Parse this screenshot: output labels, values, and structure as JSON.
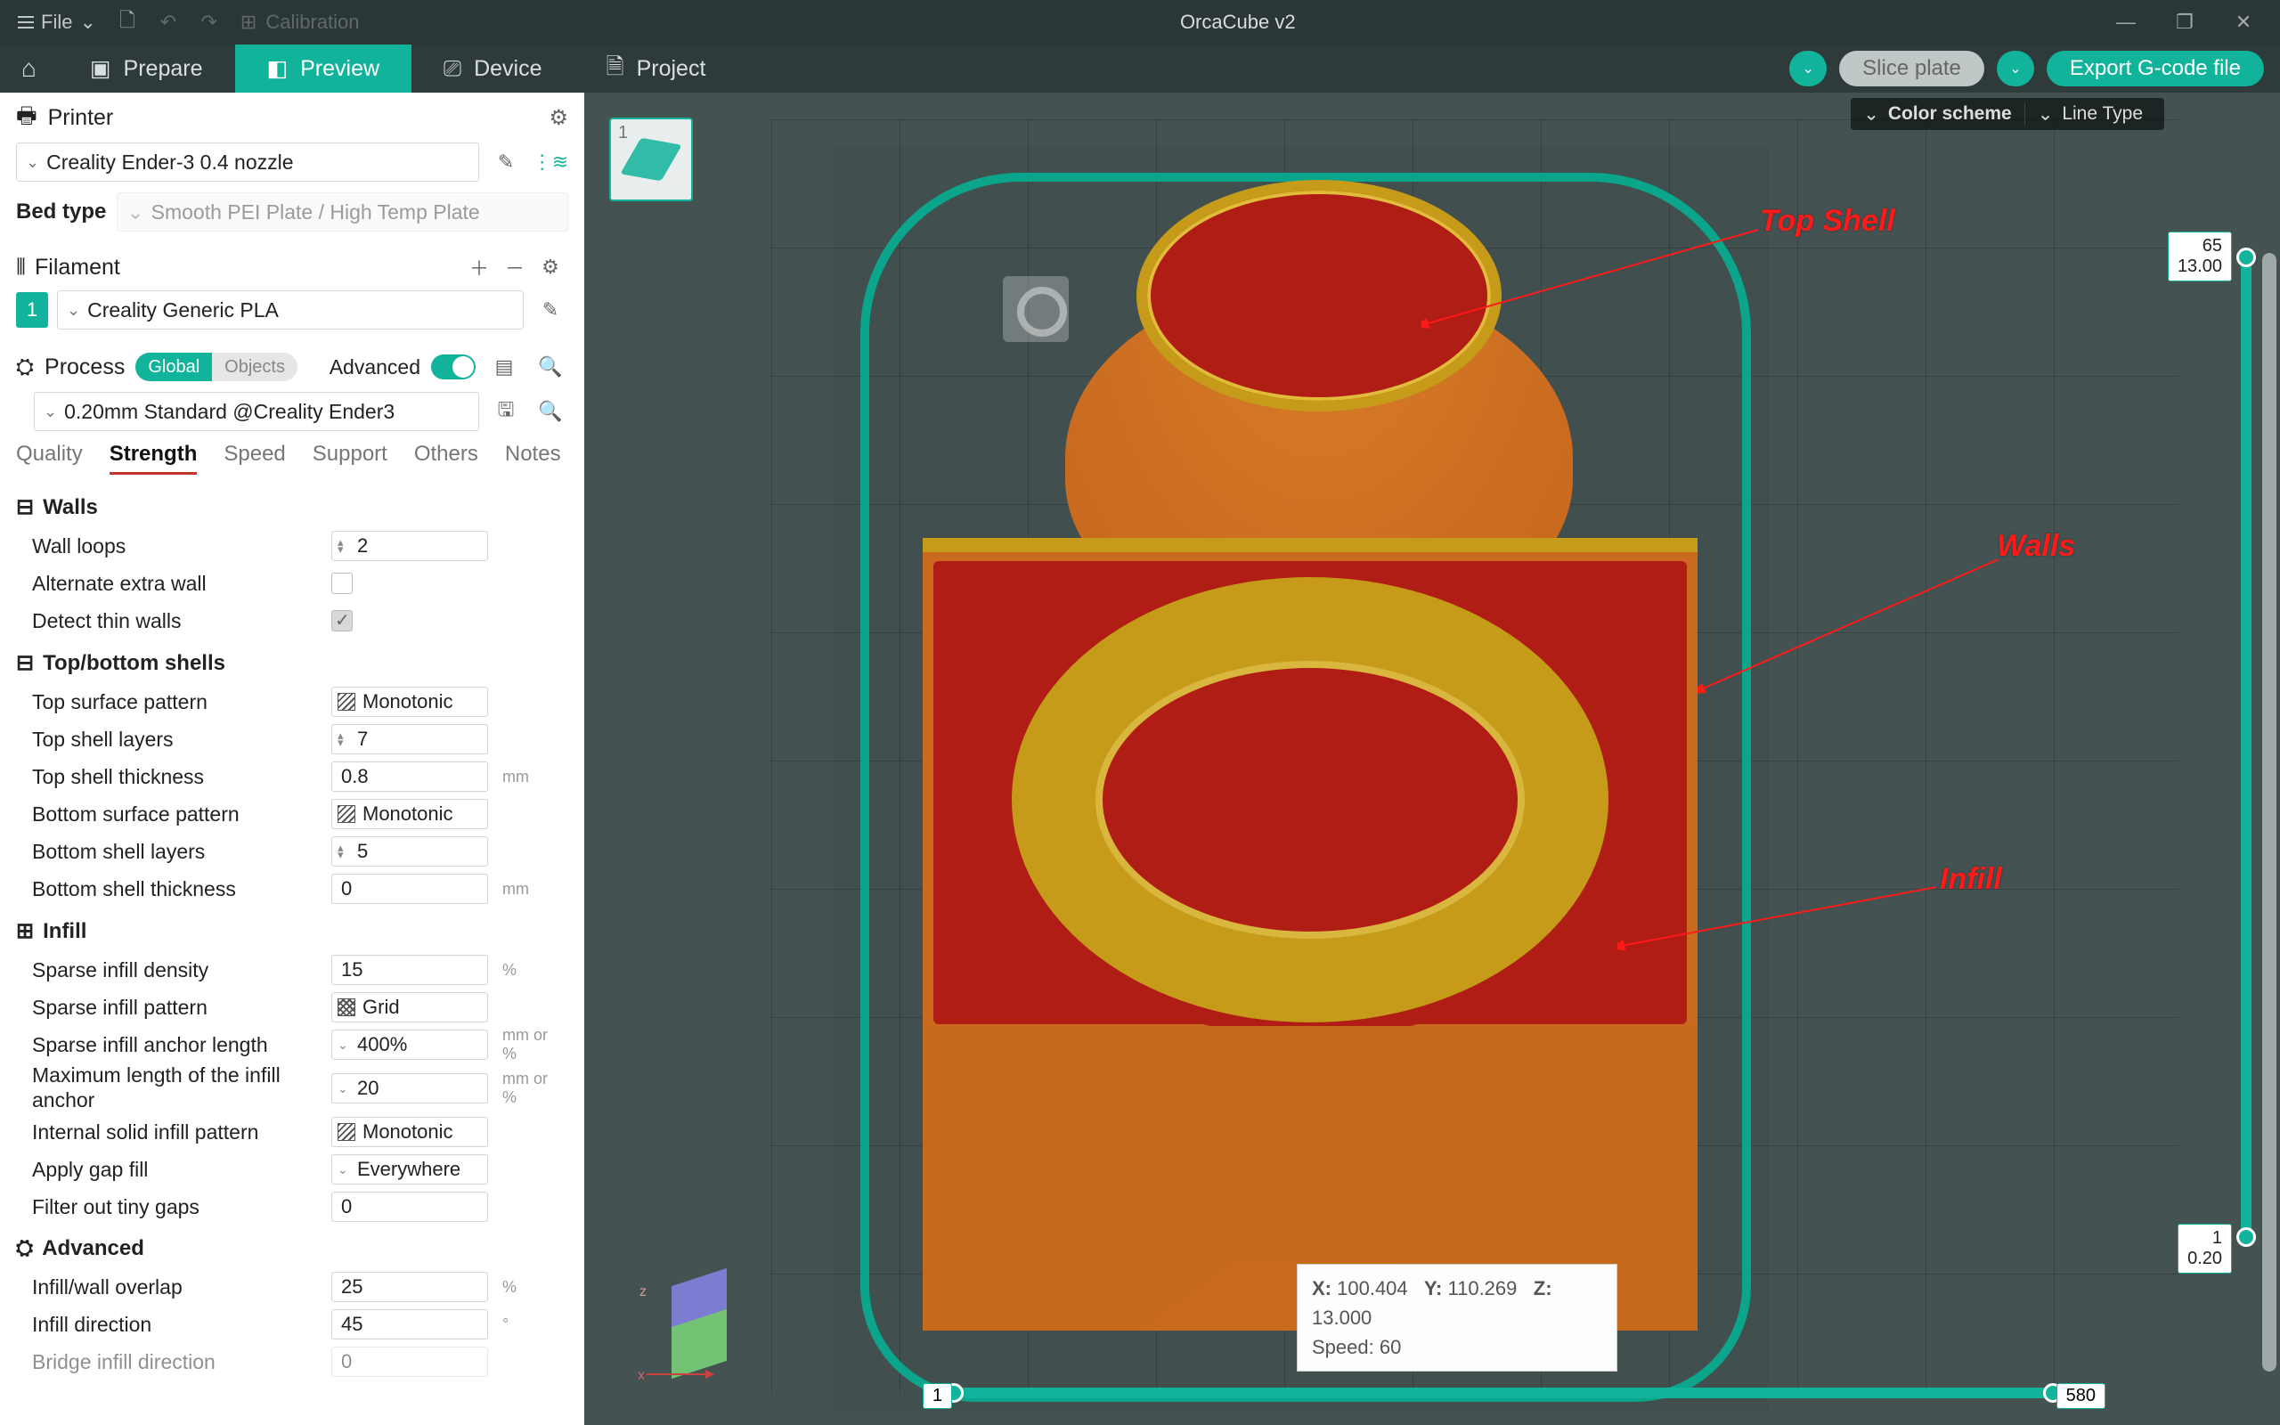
{
  "titlebar": {
    "file_label": "File",
    "calibration": "Calibration",
    "app_title": "OrcaCube v2"
  },
  "tabs": {
    "home": "",
    "prepare": "Prepare",
    "preview": "Preview",
    "device": "Device",
    "project": "Project"
  },
  "actions": {
    "slice": "Slice plate",
    "export": "Export G-code file"
  },
  "panel": {
    "printer_hdr": "Printer",
    "printer_value": "Creality Ender-3 0.4 nozzle",
    "bed_label": "Bed type",
    "bed_value": "Smooth PEI Plate / High Temp Plate",
    "filament_hdr": "Filament",
    "filament_idx": "1",
    "filament_value": "Creality Generic PLA",
    "process_hdr": "Process",
    "global": "Global",
    "objects": "Objects",
    "advanced": "Advanced",
    "process_value": "0.20mm Standard @Creality Ender3"
  },
  "ptabs": [
    "Quality",
    "Strength",
    "Speed",
    "Support",
    "Others",
    "Notes"
  ],
  "sections": {
    "walls": "Walls",
    "tb": "Top/bottom shells",
    "infill": "Infill",
    "adv": "Advanced"
  },
  "settings": {
    "wall_loops": {
      "label": "Wall loops",
      "value": "2"
    },
    "alt_extra": {
      "label": "Alternate extra wall"
    },
    "thin_walls": {
      "label": "Detect thin walls"
    },
    "top_pattern": {
      "label": "Top surface pattern",
      "value": "Monotonic"
    },
    "top_layers": {
      "label": "Top shell layers",
      "value": "7"
    },
    "top_thick": {
      "label": "Top shell thickness",
      "value": "0.8",
      "unit": "mm"
    },
    "bot_pattern": {
      "label": "Bottom surface pattern",
      "value": "Monotonic"
    },
    "bot_layers": {
      "label": "Bottom shell layers",
      "value": "5"
    },
    "bot_thick": {
      "label": "Bottom shell thickness",
      "value": "0",
      "unit": "mm"
    },
    "infill_density": {
      "label": "Sparse infill density",
      "value": "15",
      "unit": "%"
    },
    "infill_pattern": {
      "label": "Sparse infill pattern",
      "value": "Grid"
    },
    "anchor_len": {
      "label": "Sparse infill anchor length",
      "value": "400%",
      "unit": "mm or %"
    },
    "anchor_max": {
      "label": "Maximum length of the infill anchor",
      "value": "20",
      "unit": "mm or %"
    },
    "solid_pattern": {
      "label": "Internal solid infill pattern",
      "value": "Monotonic"
    },
    "gap_fill": {
      "label": "Apply gap fill",
      "value": "Everywhere"
    },
    "tiny_gaps": {
      "label": "Filter out tiny gaps",
      "value": "0"
    },
    "overlap": {
      "label": "Infill/wall overlap",
      "value": "25",
      "unit": "%"
    },
    "infill_dir": {
      "label": "Infill direction",
      "value": "45",
      "unit": "°"
    },
    "bridge_dir": {
      "label": "Bridge infill direction",
      "value": "0"
    }
  },
  "scheme": {
    "label": "Color scheme",
    "value": "Line Type"
  },
  "vslider": {
    "top_layer": "65",
    "top_z": "13.00",
    "bot_layer": "1",
    "bot_z": "0.20"
  },
  "hslider": {
    "left": "1",
    "right": "580"
  },
  "coord": {
    "x_lbl": "X:",
    "x": "100.404",
    "y_lbl": "Y:",
    "y": "110.269",
    "z_lbl": "Z:",
    "z": "13.000",
    "speed_lbl": "Speed:",
    "speed": "60"
  },
  "anno": {
    "top_shell": "Top Shell",
    "walls": "Walls",
    "infill": "Infill"
  },
  "plate_thumb": {
    "num": "1"
  }
}
